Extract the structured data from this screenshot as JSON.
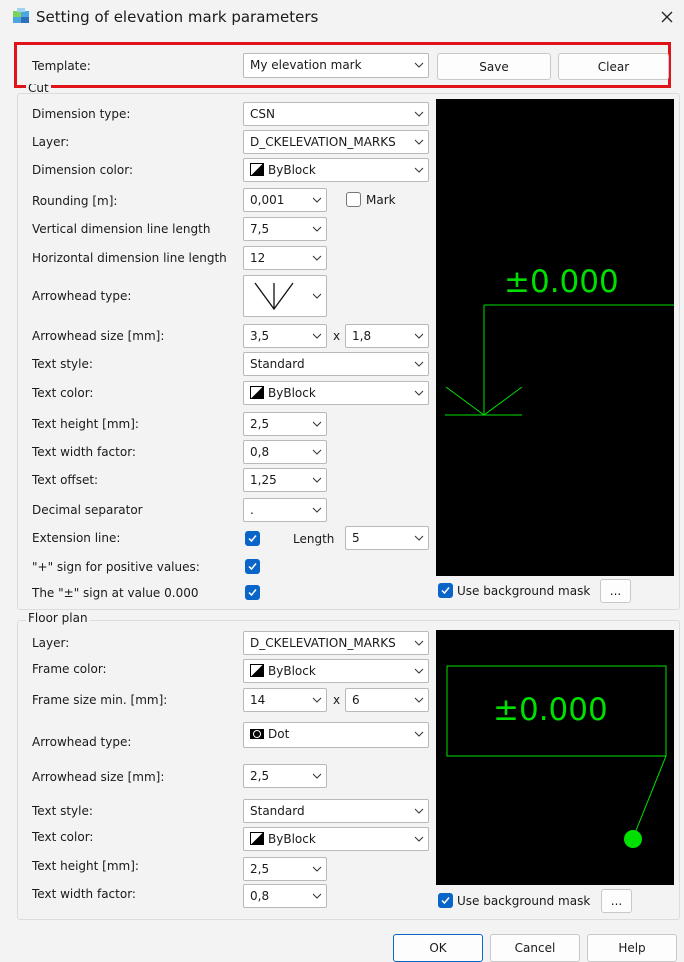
{
  "window": {
    "title": "Setting of elevation mark parameters"
  },
  "template": {
    "label": "Template:",
    "value": "My elevation mark",
    "save": "Save",
    "clear": "Clear"
  },
  "cut": {
    "group": "Cut",
    "dimension_type": {
      "label": "Dimension type:",
      "value": "CSN"
    },
    "layer": {
      "label": "Layer:",
      "value": "D_CKELEVATION_MARKS"
    },
    "dimension_color": {
      "label": "Dimension color:",
      "value": "ByBlock"
    },
    "rounding": {
      "label": "Rounding [m]:",
      "value": "0,001",
      "mark_label": "Mark",
      "mark_checked": false
    },
    "vertical_len": {
      "label": "Vertical dimension line length",
      "value": "7,5"
    },
    "horizontal_len": {
      "label": "Horizontal dimension line length",
      "value": "12"
    },
    "arrowhead_type": {
      "label": "Arrowhead type:"
    },
    "arrowhead_size": {
      "label": "Arrowhead size [mm]:",
      "value1": "3,5",
      "x": "x",
      "value2": "1,8"
    },
    "text_style": {
      "label": "Text style:",
      "value": "Standard"
    },
    "text_color": {
      "label": "Text color:",
      "value": "ByBlock"
    },
    "text_height": {
      "label": "Text height [mm]:",
      "value": "2,5"
    },
    "text_width": {
      "label": "Text width factor:",
      "value": "0,8"
    },
    "text_offset": {
      "label": "Text offset:",
      "value": "1,25"
    },
    "decimal_sep": {
      "label": "Decimal separator",
      "value": "."
    },
    "extension_line": {
      "label": "Extension line:",
      "checked": true,
      "length_label": "Length",
      "length_value": "5"
    },
    "plus_sign": {
      "label": "\"+\" sign for positive values:",
      "checked": true
    },
    "pm_sign": {
      "label": "The \"±\" sign at value 0.000",
      "checked": true
    },
    "preview_text": "±0.000",
    "bg_mask": {
      "label": "Use background mask",
      "checked": true,
      "more": "..."
    }
  },
  "floor": {
    "group": "Floor plan",
    "layer": {
      "label": "Layer:",
      "value": "D_CKELEVATION_MARKS"
    },
    "frame_color": {
      "label": "Frame color:",
      "value": "ByBlock"
    },
    "frame_size": {
      "label": "Frame size min. [mm]:",
      "value1": "14",
      "x": "x",
      "value2": "6"
    },
    "arrowhead_type": {
      "label": "Arrowhead type:",
      "value": "Dot"
    },
    "arrowhead_size": {
      "label": "Arrowhead size [mm]:",
      "value": "2,5"
    },
    "text_style": {
      "label": "Text style:",
      "value": "Standard"
    },
    "text_color": {
      "label": "Text color:",
      "value": "ByBlock"
    },
    "text_height": {
      "label": "Text height [mm]:",
      "value": "2,5"
    },
    "text_width": {
      "label": "Text width factor:",
      "value": "0,8"
    },
    "preview_text": "±0.000",
    "bg_mask": {
      "label": "Use background mask",
      "checked": true,
      "more": "..."
    }
  },
  "footer": {
    "ok": "OK",
    "cancel": "Cancel",
    "help": "Help"
  },
  "colors": {
    "accent": "#0a65c9",
    "preview_bg": "#000000",
    "preview_fg": "#00e000",
    "highlight": "#e0131b"
  }
}
